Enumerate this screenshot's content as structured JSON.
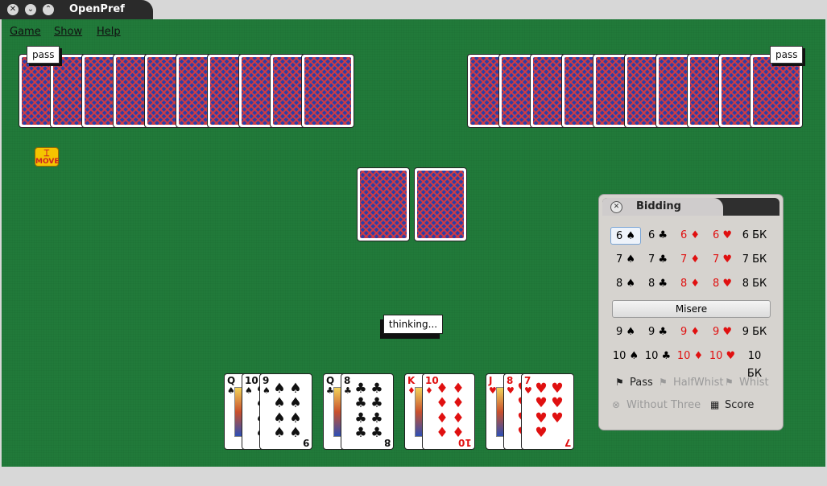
{
  "window": {
    "title": "OpenPref"
  },
  "menu": {
    "game": "Game",
    "show": "Show",
    "help": "Help"
  },
  "players": {
    "left_status": "pass",
    "right_status": "pass",
    "move_badge": "MOVE"
  },
  "thinking_label": "thinking...",
  "hand": [
    {
      "rank": "Q",
      "suit": "♠",
      "color": "black"
    },
    {
      "rank": "10",
      "suit": "♠",
      "color": "black"
    },
    {
      "rank": "9",
      "suit": "♠",
      "color": "black"
    },
    {
      "rank": "Q",
      "suit": "♣",
      "color": "black"
    },
    {
      "rank": "8",
      "suit": "♣",
      "color": "black"
    },
    {
      "rank": "K",
      "suit": "♦",
      "color": "red"
    },
    {
      "rank": "10",
      "suit": "♦",
      "color": "red"
    },
    {
      "rank": "J",
      "suit": "♥",
      "color": "red"
    },
    {
      "rank": "8",
      "suit": "♥",
      "color": "red"
    },
    {
      "rank": "7",
      "suit": "♥",
      "color": "red"
    }
  ],
  "bidding": {
    "title": "Bidding",
    "rows_top": [
      [
        "6 ♠",
        "6 ♣",
        "6 ♦",
        "6 ♥",
        "6 БК"
      ],
      [
        "7 ♠",
        "7 ♣",
        "7 ♦",
        "7 ♥",
        "7 БК"
      ],
      [
        "8 ♠",
        "8 ♣",
        "8 ♦",
        "8 ♥",
        "8 БК"
      ]
    ],
    "misere": "Misere",
    "rows_bottom": [
      [
        "9 ♠",
        "9 ♣",
        "9 ♦",
        "9 ♥",
        "9 БК"
      ],
      [
        "10 ♠",
        "10 ♣",
        "10 ♦",
        "10 ♥",
        "10 БК"
      ]
    ],
    "pass": "Pass",
    "halfwhist": "HalfWhist",
    "whist": "Whist",
    "without_three": "Without Three",
    "score": "Score"
  }
}
